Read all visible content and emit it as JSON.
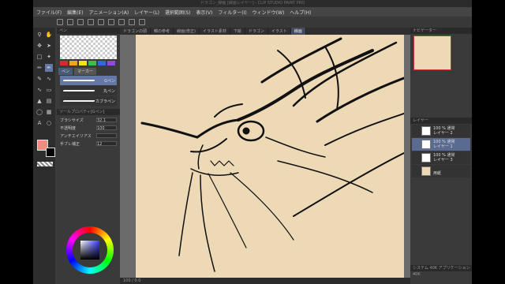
{
  "window": {
    "title": "ドラゴン_線画 [線画レイヤー] - CLIP STUDIO PAINT PRO"
  },
  "menu": [
    "ファイル(F)",
    "編集(E)",
    "アニメーション(A)",
    "レイヤー(L)",
    "選択範囲(S)",
    "表示(V)",
    "フィルター(I)",
    "ウィンドウ(W)",
    "ヘルプ(H)"
  ],
  "doc_tabs": [
    "ドラゴンの頭",
    "鱗の参考",
    "線画(修正)",
    "イラスト素材",
    "下絵",
    "ドラゴン",
    "イラスト",
    "線画"
  ],
  "subtool": {
    "header": "ペン",
    "tabs": [
      "ペン",
      "マーカー"
    ],
    "brushes": [
      {
        "label": "Gペン",
        "selected": true
      },
      {
        "label": "丸ペン",
        "selected": false
      },
      {
        "label": "カブラペン",
        "selected": false
      }
    ],
    "props_header": "ツールプロパティ[Gペン]",
    "props": [
      {
        "label": "ブラシサイズ",
        "value": "32.1"
      },
      {
        "label": "不透明度",
        "value": "100"
      },
      {
        "label": "アンチエイリアス",
        "value": ""
      },
      {
        "label": "手ブレ補正",
        "value": "12"
      }
    ]
  },
  "palette_colors": [
    "#d92b2b",
    "#f2a31b",
    "#f2e21b",
    "#3bbf4a",
    "#2b6ad9",
    "#8f4ad9"
  ],
  "status": {
    "zoom": "100",
    "position": "0.0"
  },
  "navigator_header": "ナビゲーター",
  "layers": {
    "header": "レイヤー",
    "items": [
      {
        "line1": "100 % 通常",
        "line2": "レイヤー 2",
        "selected": false
      },
      {
        "line1": "100 % 通常",
        "line2": "レイヤー 1",
        "selected": true
      },
      {
        "line1": "100 % 通常",
        "line2": "レイヤー 3",
        "selected": false
      },
      {
        "line1": "",
        "line2": "用紙",
        "selected": false
      }
    ]
  },
  "footer": "システム 40K アプリケーション 40K"
}
